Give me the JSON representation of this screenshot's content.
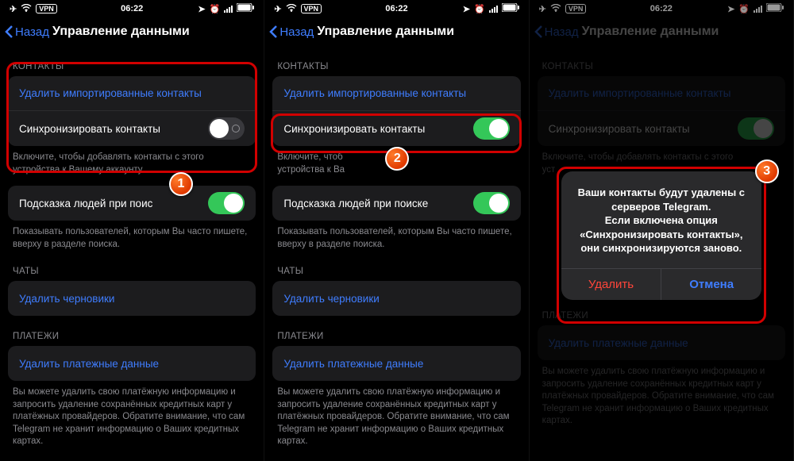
{
  "status": {
    "time": "06:22",
    "vpn": "VPN"
  },
  "nav": {
    "back": "Назад",
    "title": "Управление данными"
  },
  "sections": {
    "contacts_label": "КОНТАКТЫ",
    "delete_contacts": "Удалить импортированные контакты",
    "sync_contacts": "Синхронизировать контакты",
    "contacts_note": "Включите, чтобы добавлять контакты с этого устройства к Вашему аккаунту.",
    "contacts_note_short": "Включите, чтоб\nустройства к Ва",
    "suggest": "Подсказка людей при поиске",
    "suggest_short": "Подсказка людей при поис",
    "suggest_note": "Показывать пользователей, которым Вы часто пишете, вверху в разделе поиска.",
    "chats_label": "ЧАТЫ",
    "delete_drafts": "Удалить черновики",
    "payments_label": "ПЛАТЕЖИ",
    "delete_payments": "Удалить платежные данные",
    "payments_note": "Вы можете удалить свою платёжную информацию и запросить удаление сохранённых кредитных карт у платёжных провайдеров. Обратите внимание, что сам Telegram не хранит информацию о Ваших кредитных картах."
  },
  "alert": {
    "message": "Ваши контакты будут удалены с серверов Telegram.\nЕсли включена опция «Синхронизировать контакты», они синхронизируются заново.",
    "delete": "Удалить",
    "cancel": "Отмена"
  },
  "badges": {
    "b1": "1",
    "b2": "2",
    "b3": "3"
  }
}
